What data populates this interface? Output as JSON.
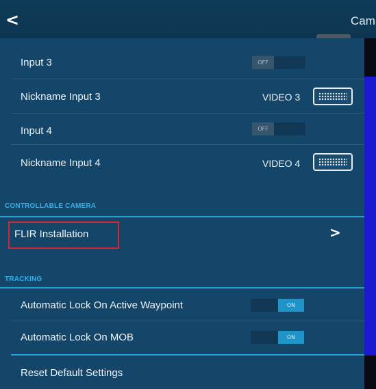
{
  "header": {
    "back_icon": "chevron-left-icon",
    "back_glyph": "<",
    "title": "Cam"
  },
  "inputs": [
    {
      "label": "Input 3",
      "toggle": "OFF"
    },
    {
      "label": "Nickname Input 3",
      "value": "VIDEO 3",
      "icon": "keyboard-icon"
    },
    {
      "label": "Input 4",
      "toggle": "OFF"
    },
    {
      "label": "Nickname Input 4",
      "value": "VIDEO 4",
      "icon": "keyboard-icon"
    }
  ],
  "controllable_camera": {
    "heading": "CONTROLLABLE CAMERA",
    "item": {
      "label": "FLIR Installation",
      "chevron": ">",
      "icon": "chevron-right-icon"
    }
  },
  "tracking": {
    "heading": "TRACKING",
    "items": [
      {
        "label": "Automatic Lock On Active Waypoint",
        "toggle": "ON"
      },
      {
        "label": "Automatic Lock On MOB",
        "toggle": "ON"
      }
    ]
  },
  "reset": {
    "label": "Reset Default Settings"
  },
  "colors": {
    "panel": "#14466a",
    "header": "#0f3c58",
    "accent": "#2fb2e6",
    "toggle_on": "#1e94c9",
    "highlight_box": "#d8262e"
  }
}
